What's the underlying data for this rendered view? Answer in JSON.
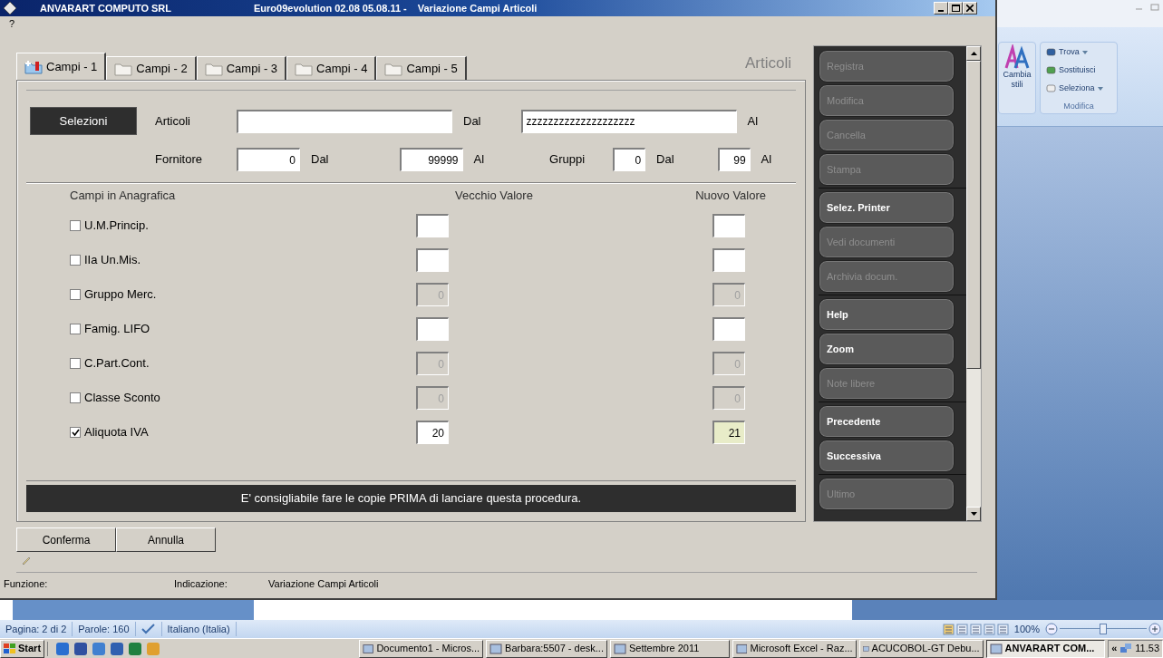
{
  "window": {
    "title_company": "ANVARART COMPUTO SRL",
    "title_version": "Euro09evolution 02.08 05.08.11 -",
    "title_form": "Variazione Campi Articoli",
    "menu": "?"
  },
  "tabs": [
    {
      "label": "Campi - 1",
      "selected": true
    },
    {
      "label": "Campi - 2",
      "selected": false
    },
    {
      "label": "Campi - 3",
      "selected": false
    },
    {
      "label": "Campi - 4",
      "selected": false
    },
    {
      "label": "Campi - 5",
      "selected": false
    }
  ],
  "section_title": "Articoli",
  "filters": {
    "button": "Selezioni",
    "articoli": {
      "label": "Articoli",
      "from_suffix": "Dal",
      "to": "zzzzzzzzzzzzzzzzzzzz",
      "to_suffix": "Al"
    },
    "fornitore": {
      "label": "Fornitore",
      "from": "0",
      "from_suffix": "Dal",
      "to": "99999",
      "to_suffix": "Al"
    },
    "gruppi": {
      "label": "Gruppi",
      "from": "0",
      "from_suffix": "Dal",
      "to": "99",
      "to_suffix": "Al"
    }
  },
  "fields_header": {
    "column_1": "Campi in Anagrafica",
    "column_2": "Vecchio Valore",
    "column_3": "Nuovo Valore"
  },
  "fields": [
    {
      "label": "U.M.Princip.",
      "checked": false,
      "old": {
        "disabled": false
      },
      "new": {
        "disabled": false,
        "focused": false
      }
    },
    {
      "label": "IIa Un.Mis.",
      "checked": false,
      "old": {
        "disabled": false
      },
      "new": {
        "disabled": false,
        "focused": false
      }
    },
    {
      "label": "Gruppo Merc.",
      "checked": false,
      "old": {
        "value": "0",
        "disabled": true
      },
      "new": {
        "value": "0",
        "disabled": true,
        "focused": false
      }
    },
    {
      "label": "Famig. LIFO",
      "checked": false,
      "old": {
        "disabled": false
      },
      "new": {
        "disabled": false,
        "focused": false
      }
    },
    {
      "label": "C.Part.Cont.",
      "checked": false,
      "old": {
        "value": "0",
        "disabled": true
      },
      "new": {
        "value": "0",
        "disabled": true,
        "focused": false
      }
    },
    {
      "label": "Classe Sconto",
      "checked": false,
      "old": {
        "value": "0",
        "disabled": true
      },
      "new": {
        "value": "0",
        "disabled": true,
        "focused": false
      }
    },
    {
      "label": "Aliquota IVA",
      "checked": true,
      "old": {
        "value": "20",
        "disabled": false
      },
      "new": {
        "value": "21",
        "disabled": false,
        "focused": true
      }
    }
  ],
  "message": "E' consigliabile fare le copie PRIMA di lanciare questa procedura.",
  "sidebar_groups": [
    [
      {
        "label": "Registra",
        "disabled": true
      },
      {
        "label": "Modifica",
        "disabled": true
      },
      {
        "label": "Cancella",
        "disabled": true
      },
      {
        "label": "Stampa",
        "disabled": true
      }
    ],
    [
      {
        "label": "Selez. Printer",
        "disabled": false
      },
      {
        "label": "Vedi documenti",
        "disabled": true
      },
      {
        "label": "Archivia docum.",
        "disabled": true
      }
    ],
    [
      {
        "label": "Help",
        "disabled": false
      },
      {
        "label": "Zoom",
        "disabled": false
      },
      {
        "label": "Note libere",
        "disabled": true
      }
    ],
    [
      {
        "label": "Precedente",
        "disabled": false
      },
      {
        "label": "Successiva",
        "disabled": false
      }
    ],
    [
      {
        "label": "Ultimo",
        "disabled": true
      }
    ]
  ],
  "bottom_buttons": [
    "Conferma",
    "Annulla"
  ],
  "status": {
    "function_label": "Funzione:",
    "indication_label": "Indicazione:",
    "indication": "Variazione Campi Articoli"
  },
  "word_ribbon": {
    "styles_button": "Cambia stili",
    "edit_items": [
      {
        "label": "Trova",
        "dropdown": true
      },
      {
        "label": "Sostituisci",
        "dropdown": false
      },
      {
        "label": "Seleziona",
        "dropdown": true
      }
    ],
    "edit_group": "Modifica"
  },
  "word_status": {
    "page": "Pagina: 2 di 2",
    "words": "Parole: 160",
    "language": "Italiano (Italia)",
    "zoom": "100%",
    "zoom_slider": {
      "level": 0.5
    }
  },
  "taskbar": {
    "start": "Start",
    "tasks": [
      {
        "label": "Documento1 - Micros...",
        "selected": false
      },
      {
        "label": "Barbara:5507 - desk...",
        "selected": false
      },
      {
        "label": "Settembre 2011",
        "selected": false
      },
      {
        "label": "Microsoft Excel - Raz...",
        "selected": false
      },
      {
        "label": "ACUCOBOL-GT Debu...",
        "selected": false
      },
      {
        "label": "ANVARART COM...",
        "selected": true
      }
    ],
    "tray_toggle": "«",
    "clock": "11.53"
  }
}
